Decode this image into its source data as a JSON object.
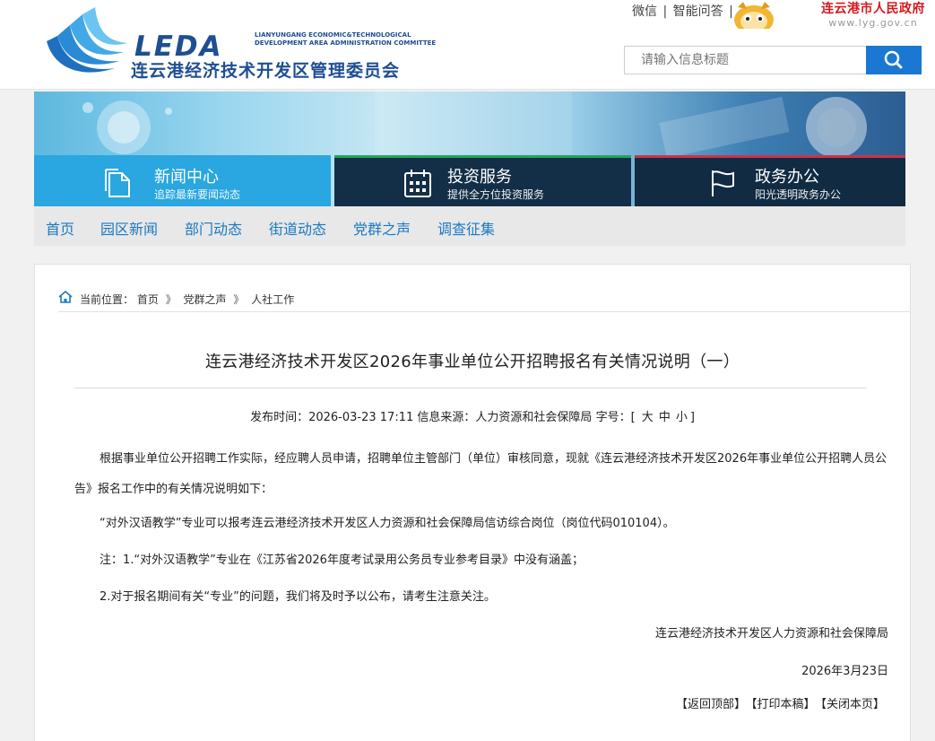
{
  "header": {
    "logo_word": "LEDA",
    "logo_en_line1": "LIANYUNGANG ECONOMIC&TECHNOLOGICAL",
    "logo_en_line2": "DEVELOPMENT AREA ADMINISTRATION COMMITTEE",
    "logo_cn": "连云港经济技术开发区管理委员会",
    "links": [
      "微信",
      "智能问答"
    ],
    "link_sep": "|",
    "gov_name": "连云港市人民政府",
    "gov_url": "www.lyg.gov.cn",
    "search_placeholder": "请输入信息标题",
    "brand_color": "#1f4e93",
    "gov_color": "#d6191f",
    "search_btn_color": "#1a78d2"
  },
  "banner": {
    "tiles": [
      {
        "title": "新闻中心",
        "subtitle": "追踪最新要闻动态",
        "icon": "document-icon",
        "color": "#2aa6e0"
      },
      {
        "title": "投资服务",
        "subtitle": "提供全方位投资服务",
        "icon": "calendar-icon",
        "color": "#132f47",
        "accent": "#27a35a"
      },
      {
        "title": "政务办公",
        "subtitle": "阳光透明政务办公",
        "icon": "flag-icon",
        "color": "#102b42",
        "accent": "#c9344b"
      }
    ]
  },
  "nav": {
    "items": [
      "首页",
      "园区新闻",
      "部门动态",
      "街道动态",
      "党群之声",
      "调查征集"
    ],
    "color": "#1a78c2"
  },
  "breadcrumb": {
    "label": "当前位置：",
    "items": [
      "首页",
      "党群之声",
      "人社工作"
    ],
    "sep": "》"
  },
  "article": {
    "title": "连云港经济技术开发区2026年事业单位公开招聘报名有关情况说明（一）",
    "meta_time_label": "发布时间：",
    "meta_time": "2026-03-23 17:11",
    "meta_source_label": "信息来源：",
    "meta_source": "人力资源和社会保障局",
    "meta_fontsize_label": "字号：",
    "font_sizes": [
      "大",
      "中",
      "小"
    ],
    "paragraphs": [
      "根据事业单位公开招聘工作实际，经应聘人员申请，招聘单位主管部门（单位）审核同意，现就《连云港经济技术开发区2026年事业单位公开招聘人员公告》报名工作中的有关情况说明如下：",
      "“对外汉语教学”专业可以报考连云港经济技术开发区人力资源和社会保障局信访综合岗位（岗位代码010104）。",
      "注：1.“对外汉语教学”专业在《江苏省2026年度考试录用公务员专业参考目录》中没有涵盖；",
      "2.对于报名期间有关“专业”的问题，我们将及时予以公布，请考生注意关注。"
    ],
    "signature": "连云港经济技术开发区人力资源和社会保障局",
    "date": "2026年3月23日",
    "actions": [
      "【返回顶部】",
      "【打印本稿】",
      "【关闭本页】"
    ]
  }
}
